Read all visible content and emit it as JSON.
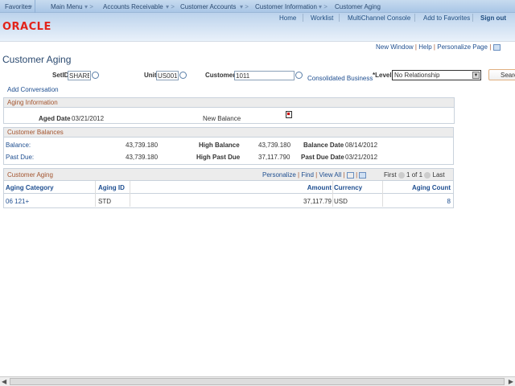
{
  "nav": {
    "favorites": "Favorites",
    "main_menu": "Main Menu",
    "crumbs": [
      "Accounts Receivable",
      "Customer Accounts",
      "Customer Information",
      "Customer Aging"
    ]
  },
  "header": {
    "links": [
      "Home",
      "Worklist",
      "MultiChannel Console",
      "Add to Favorites"
    ],
    "signout": "Sign out",
    "logo": "ORACLE"
  },
  "pagelinks": {
    "new_window": "New Window",
    "help": "Help",
    "personalize": "Personalize Page"
  },
  "page_title": "Customer Aging",
  "search": {
    "setid_label": "SetID",
    "setid": "SHARE",
    "unit_label": "Unit",
    "unit": "US001",
    "customer_label": "Customer",
    "customer": "1011",
    "consolidated": "Consolidated Business",
    "level_label": "*Level",
    "level": "No Relationship",
    "search_button": "Search"
  },
  "add_conversation": "Add Conversation",
  "aging_info": {
    "title": "Aging Information",
    "aged_date_label": "Aged Date",
    "aged_date": "03/21/2012",
    "new_balance_label": "New Balance"
  },
  "balances": {
    "title": "Customer Balances",
    "balance_label": "Balance:",
    "balance": "43,739.180",
    "past_due_label": "Past Due:",
    "past_due": "43,739.180",
    "high_balance_label": "High Balance",
    "high_balance": "43,739.180",
    "high_past_due_label": "High Past Due",
    "high_past_due": "37,117.790",
    "balance_date_label": "Balance Date",
    "balance_date": "08/14/2012",
    "past_due_date_label": "Past Due Date",
    "past_due_date": "03/21/2012"
  },
  "aging_grid": {
    "title": "Customer Aging",
    "personalize": "Personalize",
    "find": "Find",
    "view_all": "View All",
    "first": "First",
    "pager": "1 of 1",
    "last": "Last",
    "columns": [
      "Aging Category",
      "Aging ID",
      "Amount",
      "Currency",
      "Aging Count"
    ],
    "rows": [
      {
        "category": "06 121+",
        "aging_id": "STD",
        "amount": "37,117.79",
        "currency": "USD",
        "count": "8"
      }
    ]
  }
}
